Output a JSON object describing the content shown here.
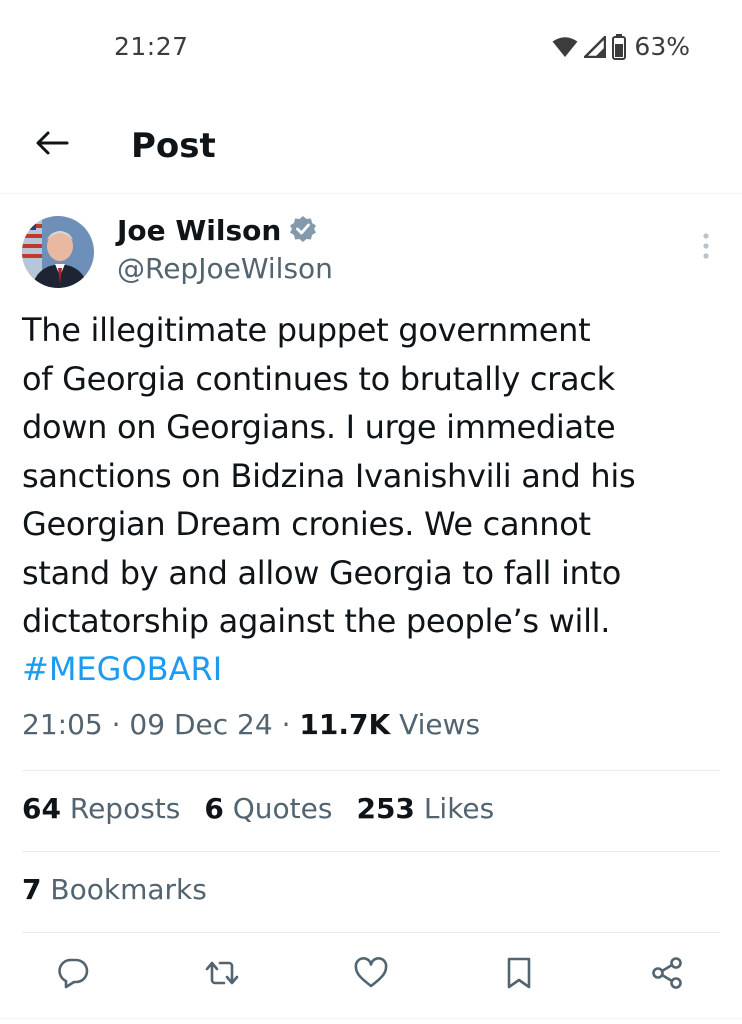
{
  "status_bar": {
    "time": "21:27",
    "battery": "63%",
    "icons": [
      "wifi-icon",
      "signal-icon",
      "battery-icon"
    ]
  },
  "header": {
    "title": "Post",
    "back_icon": "arrow-left-icon"
  },
  "author": {
    "name": "Joe Wilson",
    "handle": "@RepJoeWilson",
    "verified": true
  },
  "tweet": {
    "lines": [
      "The illegitimate puppet government",
      "of Georgia continues to brutally crack",
      "down on Georgians. I urge immediate",
      "sanctions on Bidzina Ivanishvili and his",
      "Georgian Dream cronies. We cannot",
      "stand by and allow Georgia to fall into",
      "dictatorship against the people’s will."
    ],
    "hashtag": "#MEGOBARI",
    "time": "21:05",
    "date": "09 Dec 24",
    "views_count": "11.7K",
    "views_label": "Views",
    "separator": "·"
  },
  "stats": {
    "reposts_count": "64",
    "reposts_label": "Reposts",
    "quotes_count": "6",
    "quotes_label": "Quotes",
    "likes_count": "253",
    "likes_label": "Likes",
    "bookmarks_count": "7",
    "bookmarks_label": "Bookmarks"
  },
  "actions": [
    "reply-icon",
    "repost-icon",
    "like-icon",
    "bookmark-icon",
    "share-icon"
  ],
  "colors": {
    "link": "#1d9bf0",
    "secondary_text": "#536471",
    "primary_text": "#0f1419",
    "verified_badge": "#829aab"
  }
}
